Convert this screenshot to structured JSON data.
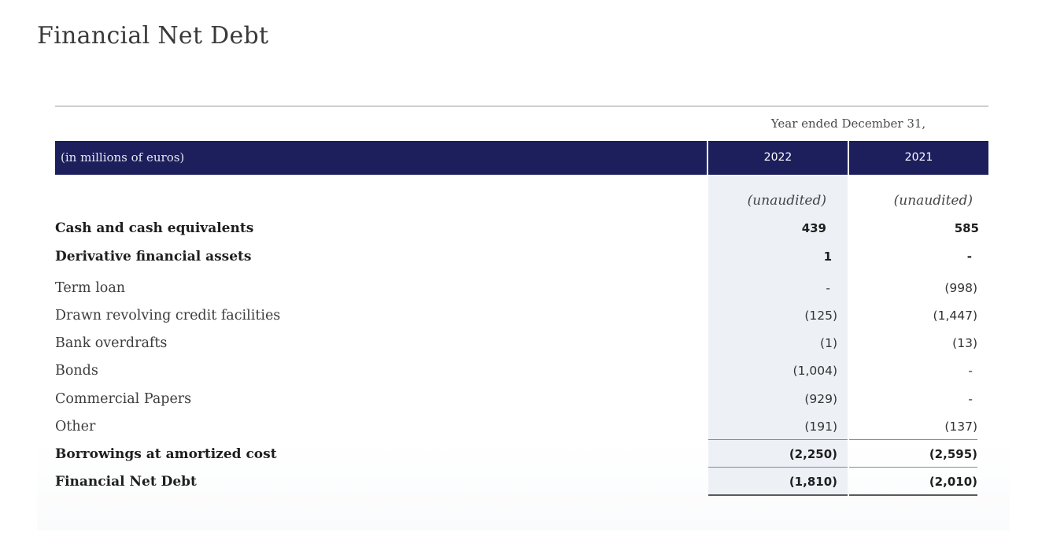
{
  "page": {
    "title": "Financial Net Debt"
  },
  "table": {
    "period_caption": "Year ended December 31,",
    "header": {
      "units_label": "(in millions of euros)",
      "years": [
        "2022",
        "2021"
      ]
    },
    "audit_status": [
      "(unaudited)",
      "(unaudited)"
    ],
    "rows": [
      {
        "label": "Cash and cash equivalents",
        "bold": true,
        "values": [
          "439",
          "585"
        ]
      },
      {
        "label": "Derivative financial assets",
        "bold": true,
        "values": [
          "1",
          "-"
        ]
      },
      {
        "label": "Term loan",
        "bold": false,
        "values": [
          "-",
          "(998)"
        ]
      },
      {
        "label": "Drawn revolving credit facilities",
        "bold": false,
        "values": [
          "(125)",
          "(1,447)"
        ]
      },
      {
        "label": "Bank overdrafts",
        "bold": false,
        "values": [
          "(1)",
          "(13)"
        ]
      },
      {
        "label": "Bonds",
        "bold": false,
        "values": [
          "(1,004)",
          "-"
        ]
      },
      {
        "label": "Commercial Papers",
        "bold": false,
        "values": [
          "(929)",
          "-"
        ]
      },
      {
        "label": "Other",
        "bold": false,
        "values": [
          "(191)",
          "(137)"
        ]
      },
      {
        "label": "Borrowings at amortized cost",
        "bold": true,
        "values": [
          "(2,250)",
          "(2,595)"
        ]
      },
      {
        "label": "Financial Net Debt",
        "bold": true,
        "values": [
          "(1,810)",
          "(2,010)"
        ]
      }
    ]
  },
  "colors": {
    "header_background": "#1d1f5c",
    "highlight_column": "#edf1f6",
    "text": "#222222"
  }
}
